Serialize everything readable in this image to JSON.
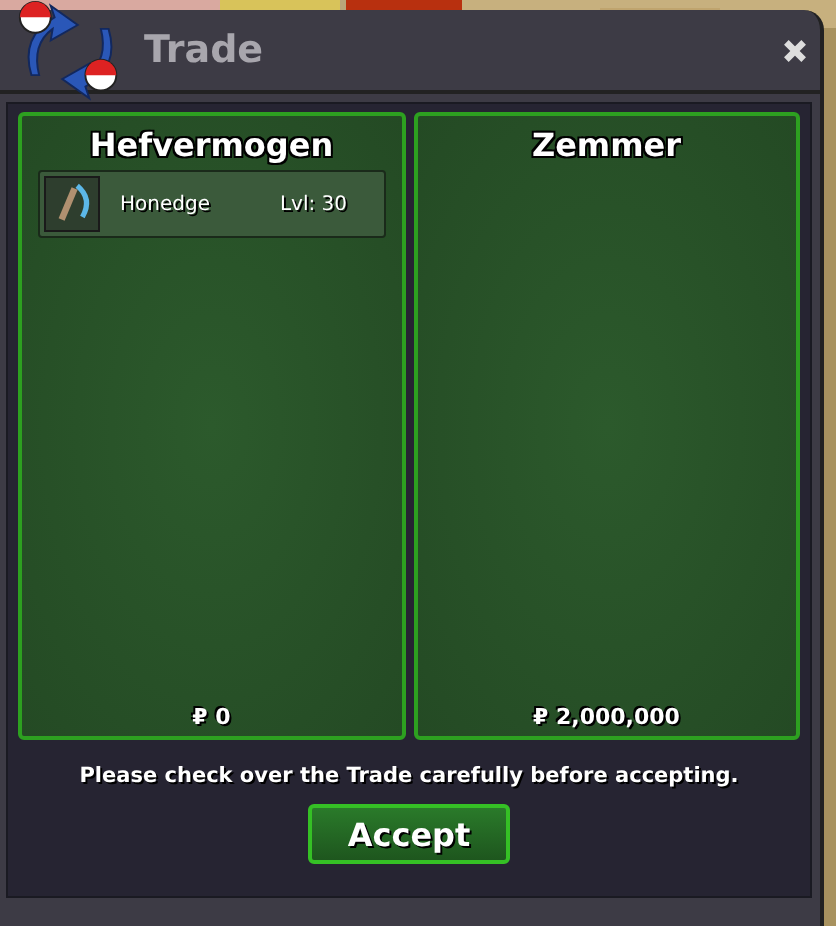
{
  "window": {
    "title": "Trade"
  },
  "panels": [
    {
      "name": "Hefvermogen",
      "items": [
        {
          "name": "Honedge",
          "level": "Lvl: 30"
        }
      ],
      "money": "₽ 0"
    },
    {
      "name": "Zemmer",
      "money": "₽ 2,000,000"
    }
  ],
  "notice": "Please check over the Trade carefully before accepting.",
  "buttons": [
    {
      "label": "Accept"
    }
  ]
}
